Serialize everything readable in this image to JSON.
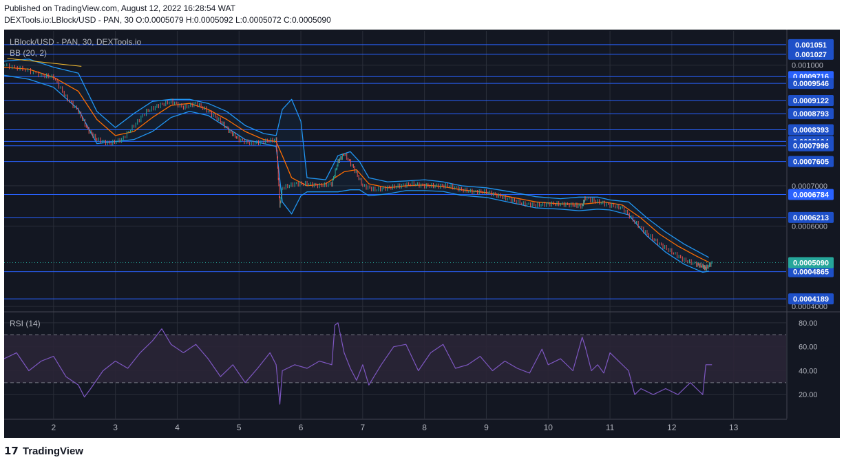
{
  "header": {
    "published": "Published on TradingView.com, August 12, 2022 16:28:54 WAT",
    "ohlc": "DEXTools.io:LBlock/USD - PAN, 30  O:0.0005079 H:0.0005092 L:0.0005072 C:0.0005090"
  },
  "footer": {
    "logo_glyph": "17",
    "brand": "TradingView"
  },
  "colors": {
    "background": "#131722",
    "grid": "#2a2e39",
    "axis_text": "#b2b5be",
    "level_line": "#2962ff",
    "bb_band": "#2196f3",
    "bb_basis": "#ff6d00",
    "trendline": "#fbc02d",
    "rsi_line": "#7e57c2",
    "rsi_band": "#2a2536",
    "candle_up": "#26a69a",
    "candle_down": "#ef5350",
    "last_price_label": "#26a69a",
    "level_label": "#1e50c8",
    "level_label_selected": "#2962ff"
  },
  "chart_data": [
    {
      "type": "line",
      "title": "LBlock/USD - PAN, 30, DEXTools.io",
      "indicator": "BB (20, 2)",
      "x_tick_labels": [
        "2",
        "3",
        "4",
        "5",
        "6",
        "7",
        "8",
        "9",
        "10",
        "11",
        "12",
        "13"
      ],
      "y_tick_labels": [
        "0.001000",
        "0.0007000",
        "0.0006000",
        "0.0004000"
      ],
      "ylim": [
        0.00039,
        0.001085
      ],
      "xlim": [
        1.2,
        13.85
      ],
      "horizontal_levels": [
        {
          "label": "0.001051",
          "value": 0.001051
        },
        {
          "label": "0.001027",
          "value": 0.001027
        },
        {
          "label": "0.0009716",
          "value": 0.0009716
        },
        {
          "label": "0.0009546",
          "value": 0.0009546
        },
        {
          "label": "0.0009122",
          "value": 0.0009122
        },
        {
          "label": "0.0008793",
          "value": 0.0008793
        },
        {
          "label": "0.0008393",
          "value": 0.0008393
        },
        {
          "label": "0.0008104",
          "value": 0.0008104
        },
        {
          "label": "0.0007996",
          "value": 0.0007996
        },
        {
          "label": "0.0007605",
          "value": 0.0007605
        },
        {
          "label": "0.0006784",
          "value": 0.0006784
        },
        {
          "label": "0.0006213",
          "value": 0.0006213
        },
        {
          "label": "0.0004865",
          "value": 0.0004865
        },
        {
          "label": "0.0004189",
          "value": 0.0004189
        }
      ],
      "last_price": {
        "label": "0.0005090",
        "value": 0.000509
      },
      "trendline": [
        {
          "x": 1.25,
          "y": 0.001017
        },
        {
          "x": 2.45,
          "y": 0.000997
        }
      ],
      "series": [
        {
          "name": "Close",
          "x": [
            1.2,
            1.5,
            1.8,
            2.0,
            2.2,
            2.4,
            2.55,
            2.7,
            2.9,
            3.1,
            3.3,
            3.5,
            3.7,
            3.9,
            4.1,
            4.3,
            4.5,
            4.7,
            4.85,
            5.0,
            5.2,
            5.4,
            5.6,
            5.66,
            5.7,
            5.9,
            6.1,
            6.3,
            6.5,
            6.6,
            6.7,
            6.85,
            7.0,
            7.2,
            7.4,
            7.6,
            7.8,
            8.0,
            8.2,
            8.4,
            8.6,
            8.8,
            9.0,
            9.2,
            9.4,
            9.6,
            9.8,
            10.0,
            10.2,
            10.4,
            10.55,
            10.6,
            10.8,
            11.0,
            11.2,
            11.4,
            11.6,
            11.8,
            12.0,
            12.2,
            12.4,
            12.5,
            12.55,
            12.65
          ],
          "y": [
            0.001,
            0.00099,
            0.000975,
            0.00097,
            0.00092,
            0.000885,
            0.00084,
            0.000815,
            0.000805,
            0.000815,
            0.00085,
            0.000885,
            0.0009,
            0.00091,
            0.000895,
            0.000905,
            0.000885,
            0.00086,
            0.000835,
            0.000815,
            0.000805,
            0.00081,
            0.000815,
            0.00065,
            0.000695,
            0.000705,
            0.000705,
            0.0007,
            0.000705,
            0.00076,
            0.00078,
            0.000745,
            0.0007,
            0.00069,
            0.000695,
            0.0007,
            0.000705,
            0.0007,
            0.0007,
            0.0007,
            0.00069,
            0.000685,
            0.000685,
            0.000675,
            0.000665,
            0.000655,
            0.000652,
            0.000655,
            0.000655,
            0.000652,
            0.00065,
            0.00067,
            0.00066,
            0.000652,
            0.000645,
            0.00061,
            0.00058,
            0.000555,
            0.000535,
            0.000515,
            0.000505,
            0.0005,
            0.000495,
            0.000509
          ]
        },
        {
          "name": "Basis",
          "x": [
            1.2,
            1.6,
            2.0,
            2.4,
            2.7,
            3.0,
            3.3,
            3.6,
            3.9,
            4.2,
            4.5,
            4.8,
            5.1,
            5.4,
            5.6,
            5.7,
            5.85,
            6.1,
            6.4,
            6.7,
            6.9,
            7.1,
            7.4,
            7.7,
            8.0,
            8.3,
            8.6,
            9.0,
            9.4,
            9.8,
            10.2,
            10.6,
            10.9,
            11.2,
            11.5,
            11.8,
            12.1,
            12.4,
            12.6
          ],
          "y": [
            0.000995,
            0.00099,
            0.00097,
            0.000935,
            0.000865,
            0.000825,
            0.000835,
            0.00087,
            0.0009,
            0.000905,
            0.00089,
            0.000865,
            0.000835,
            0.000815,
            0.00081,
            0.000775,
            0.00072,
            0.0007,
            0.000705,
            0.000735,
            0.00074,
            0.000705,
            0.000695,
            0.0007,
            0.000702,
            0.000698,
            0.00069,
            0.000683,
            0.000672,
            0.00066,
            0.000655,
            0.000655,
            0.00066,
            0.000652,
            0.00062,
            0.00058,
            0.00055,
            0.000525,
            0.00051
          ]
        },
        {
          "name": "Upper",
          "x": [
            1.2,
            1.6,
            2.0,
            2.4,
            2.7,
            3.0,
            3.3,
            3.6,
            3.9,
            4.2,
            4.5,
            4.8,
            5.1,
            5.4,
            5.6,
            5.7,
            5.85,
            6.0,
            6.1,
            6.4,
            6.6,
            6.8,
            6.95,
            7.1,
            7.4,
            7.7,
            8.0,
            8.3,
            8.6,
            9.0,
            9.4,
            9.8,
            10.2,
            10.5,
            10.8,
            11.0,
            11.3,
            11.6,
            11.9,
            12.2,
            12.5,
            12.6
          ],
          "y": [
            0.00101,
            0.001015,
            0.000995,
            0.00098,
            0.000885,
            0.000845,
            0.00088,
            0.00091,
            0.000915,
            0.000915,
            0.000905,
            0.000885,
            0.00085,
            0.00083,
            0.000825,
            0.00089,
            0.000915,
            0.00086,
            0.00072,
            0.000715,
            0.000775,
            0.000785,
            0.00076,
            0.00072,
            0.00071,
            0.000712,
            0.000715,
            0.00071,
            0.0007,
            0.000695,
            0.000685,
            0.000673,
            0.000668,
            0.000672,
            0.000672,
            0.000665,
            0.00066,
            0.00062,
            0.000585,
            0.000555,
            0.00053,
            0.000522
          ]
        },
        {
          "name": "Lower",
          "x": [
            1.2,
            1.6,
            2.0,
            2.4,
            2.7,
            3.0,
            3.3,
            3.6,
            3.9,
            4.2,
            4.5,
            4.8,
            5.1,
            5.4,
            5.6,
            5.7,
            5.85,
            6.0,
            6.1,
            6.4,
            6.6,
            6.8,
            6.95,
            7.1,
            7.4,
            7.7,
            8.0,
            8.3,
            8.6,
            9.0,
            9.4,
            9.8,
            10.2,
            10.5,
            10.8,
            11.0,
            11.3,
            11.6,
            11.9,
            12.2,
            12.5,
            12.6
          ],
          "y": [
            0.000975,
            0.000965,
            0.000945,
            0.00089,
            0.000805,
            0.00081,
            0.000815,
            0.000835,
            0.00087,
            0.000885,
            0.000875,
            0.000845,
            0.000815,
            0.000805,
            0.000798,
            0.00066,
            0.00063,
            0.000675,
            0.000685,
            0.000685,
            0.000685,
            0.00069,
            0.00069,
            0.000675,
            0.00068,
            0.000688,
            0.000688,
            0.000686,
            0.000676,
            0.000671,
            0.000658,
            0.000645,
            0.000642,
            0.000638,
            0.000642,
            0.00064,
            0.000628,
            0.000575,
            0.000535,
            0.000505,
            0.000485,
            0.000488
          ]
        }
      ]
    },
    {
      "type": "line",
      "title": "RSI (14)",
      "y_tick_labels": [
        "80.00",
        "60.00",
        "40.00",
        "20.00"
      ],
      "ylim": [
        0,
        88
      ],
      "bands": [
        30,
        70
      ],
      "series": [
        {
          "name": "RSI",
          "x": [
            1.2,
            1.4,
            1.6,
            1.8,
            2.0,
            2.2,
            2.4,
            2.5,
            2.6,
            2.8,
            3.0,
            3.2,
            3.4,
            3.6,
            3.75,
            3.9,
            4.1,
            4.3,
            4.5,
            4.7,
            4.9,
            5.1,
            5.3,
            5.5,
            5.6,
            5.66,
            5.7,
            5.9,
            6.1,
            6.3,
            6.5,
            6.55,
            6.6,
            6.7,
            6.8,
            6.9,
            7.0,
            7.1,
            7.3,
            7.5,
            7.7,
            7.9,
            8.1,
            8.3,
            8.5,
            8.7,
            8.9,
            9.1,
            9.3,
            9.5,
            9.7,
            9.9,
            10.0,
            10.2,
            10.4,
            10.55,
            10.6,
            10.7,
            10.8,
            10.9,
            11.0,
            11.1,
            11.3,
            11.4,
            11.5,
            11.7,
            11.9,
            12.1,
            12.3,
            12.5,
            12.55,
            12.65
          ],
          "y": [
            50,
            55,
            40,
            48,
            52,
            35,
            28,
            18,
            25,
            40,
            48,
            42,
            55,
            65,
            75,
            62,
            55,
            62,
            50,
            35,
            45,
            30,
            42,
            55,
            45,
            12,
            40,
            45,
            42,
            48,
            45,
            78,
            80,
            55,
            42,
            32,
            45,
            28,
            45,
            60,
            62,
            40,
            55,
            62,
            42,
            45,
            52,
            40,
            48,
            42,
            38,
            58,
            45,
            50,
            40,
            68,
            60,
            40,
            45,
            38,
            55,
            50,
            40,
            20,
            25,
            20,
            25,
            20,
            30,
            20,
            45,
            45
          ]
        }
      ]
    }
  ]
}
